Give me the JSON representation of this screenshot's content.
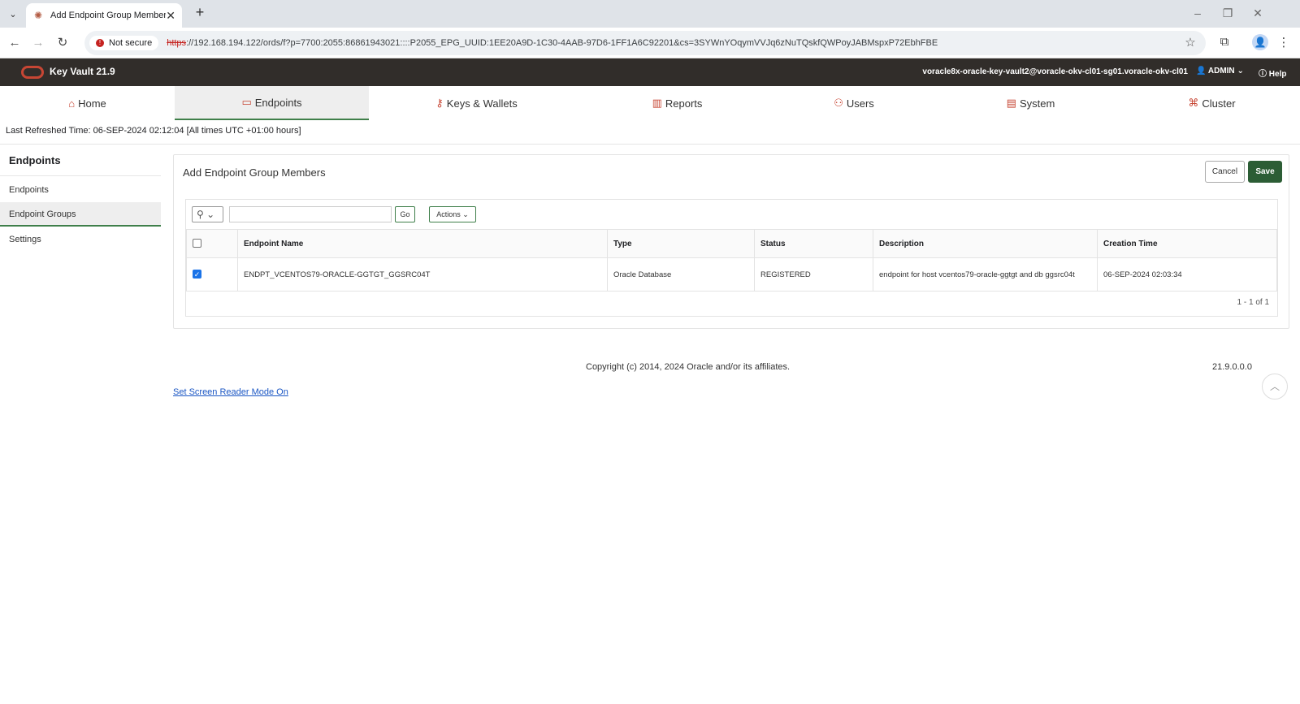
{
  "browser": {
    "tab_title": "Add Endpoint Group Members",
    "new_tab": "+",
    "not_secure": "Not secure",
    "url_scheme": "https",
    "url_rest": "://192.168.194.122/ords/f?p=7700:2055:86861943021::::P2055_EPG_UUID:1EE20A9D-1C30-4AAB-97D6-1FF1A6C92201&cs=3SYWnYOqymVVJq6zNuTQskfQWPoyJABMspxP72EbhFBE"
  },
  "app": {
    "title": "Key Vault 21.9",
    "hostname": "voracle8x-oracle-key-vault2@voracle-okv-cl01-sg01.voracle-okv-cl01",
    "user": "ADMIN",
    "help": "Help"
  },
  "nav": {
    "home": "Home",
    "endpoints": "Endpoints",
    "keys_wallets": "Keys & Wallets",
    "reports": "Reports",
    "users": "Users",
    "system": "System",
    "cluster": "Cluster"
  },
  "refresh_text": "Last Refreshed Time: 06-SEP-2024 02:12:04 [All times UTC +01:00 hours]",
  "sidebar": {
    "heading": "Endpoints",
    "items": [
      "Endpoints",
      "Endpoint Groups",
      "Settings"
    ]
  },
  "region": {
    "title": "Add Endpoint Group Members",
    "cancel": "Cancel",
    "save": "Save",
    "go": "Go",
    "actions": "Actions",
    "columns": [
      "Endpoint Name",
      "Type",
      "Status",
      "Description",
      "Creation Time"
    ],
    "rows": [
      {
        "checked": true,
        "name": "ENDPT_VCENTOS79-ORACLE-GGTGT_GGSRC04T",
        "type": "Oracle Database",
        "status": "REGISTERED",
        "description": "endpoint for host vcentos79-oracle-ggtgt and db ggsrc04t",
        "created": "06-SEP-2024 02:03:34"
      }
    ],
    "pager": "1 - 1 of 1"
  },
  "footer": {
    "copyright": "Copyright (c) 2014, 2024 Oracle and/or its affiliates.",
    "version": "21.9.0.0.0",
    "screen_reader": "Set Screen Reader Mode On"
  },
  "colors": {
    "header_bg": "#312d2a",
    "accent_green": "#2c5d35",
    "oracle_red": "#c74634"
  }
}
